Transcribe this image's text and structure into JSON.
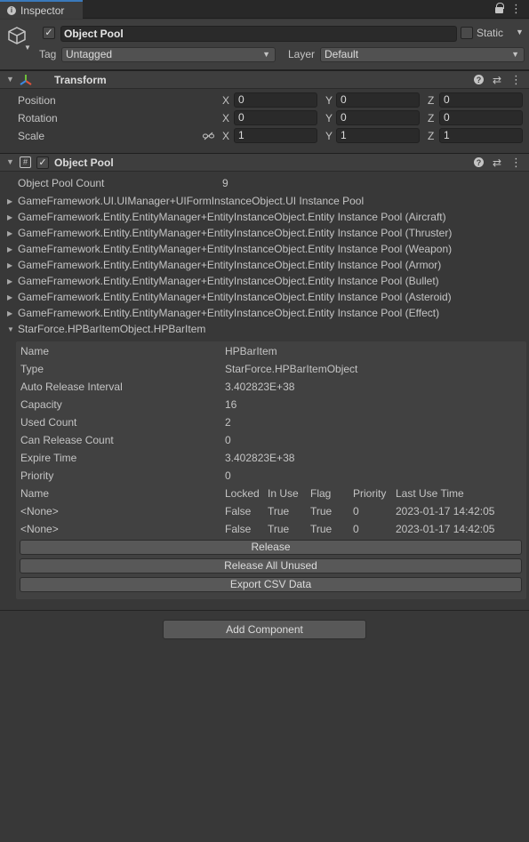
{
  "window": {
    "tab_title": "Inspector",
    "tab_icon": "info-icon",
    "tab_actions": [
      "lock-icon",
      "kebab-menu-icon"
    ]
  },
  "game_object": {
    "icon": "cube-icon",
    "active": true,
    "name": "Object Pool",
    "static_checked": false,
    "static_label": "Static",
    "tag_label": "Tag",
    "tag_value": "Untagged",
    "layer_label": "Layer",
    "layer_value": "Default"
  },
  "transform": {
    "title": "Transform",
    "icon": "transform-axes-icon",
    "rows": [
      {
        "label": "Position",
        "x": "0",
        "y": "0",
        "z": "0"
      },
      {
        "label": "Rotation",
        "x": "0",
        "y": "0",
        "z": "0"
      },
      {
        "label": "Scale",
        "x": "1",
        "y": "1",
        "z": "1"
      }
    ],
    "axis_labels": [
      "X",
      "Y",
      "Z"
    ]
  },
  "object_pool": {
    "title": "Object Pool",
    "icon": "script-hash-icon",
    "enabled": true,
    "count_label": "Object Pool Count",
    "count_value": "9",
    "pools": [
      "GameFramework.UI.UIManager+UIFormInstanceObject.UI Instance Pool",
      "GameFramework.Entity.EntityManager+EntityInstanceObject.Entity Instance Pool (Aircraft)",
      "GameFramework.Entity.EntityManager+EntityInstanceObject.Entity Instance Pool (Thruster)",
      "GameFramework.Entity.EntityManager+EntityInstanceObject.Entity Instance Pool (Weapon)",
      "GameFramework.Entity.EntityManager+EntityInstanceObject.Entity Instance Pool (Armor)",
      "GameFramework.Entity.EntityManager+EntityInstanceObject.Entity Instance Pool (Bullet)",
      "GameFramework.Entity.EntityManager+EntityInstanceObject.Entity Instance Pool (Asteroid)",
      "GameFramework.Entity.EntityManager+EntityInstanceObject.Entity Instance Pool (Effect)",
      "StarForce.HPBarItemObject.HPBarItem"
    ],
    "expanded_index": 8,
    "details": [
      {
        "label": "Name",
        "value": "HPBarItem"
      },
      {
        "label": "Type",
        "value": "StarForce.HPBarItemObject"
      },
      {
        "label": "Auto Release Interval",
        "value": "3.402823E+38"
      },
      {
        "label": "Capacity",
        "value": "16"
      },
      {
        "label": "Used Count",
        "value": "2"
      },
      {
        "label": "Can Release Count",
        "value": "0"
      },
      {
        "label": "Expire Time",
        "value": "3.402823E+38"
      },
      {
        "label": "Priority",
        "value": "0"
      }
    ],
    "table": {
      "headers": [
        "Name",
        "Locked",
        "In Use",
        "Flag",
        "Priority",
        "Last Use Time"
      ],
      "rows": [
        [
          "<None>",
          "False",
          "True",
          "True",
          "0",
          "2023-01-17 14:42:05"
        ],
        [
          "<None>",
          "False",
          "True",
          "True",
          "0",
          "2023-01-17 14:42:05"
        ]
      ]
    },
    "buttons": [
      "Release",
      "Release All Unused",
      "Export CSV Data"
    ]
  },
  "add_component_label": "Add Component",
  "colors": {
    "background": "#383838",
    "header": "#3e3e3e",
    "tab_accent": "#3a79bb",
    "field": "#2a2a2a",
    "button": "#585858"
  }
}
